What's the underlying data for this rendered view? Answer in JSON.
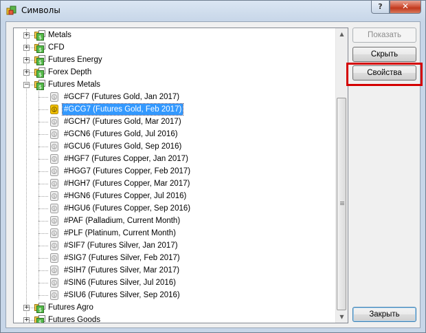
{
  "window": {
    "title": "Символы",
    "help_label": "?",
    "close_label": "✕"
  },
  "tree": {
    "top_groups": [
      {
        "label": "Metals",
        "expander": "+"
      },
      {
        "label": "CFD",
        "expander": "+"
      },
      {
        "label": "Futures Energy",
        "expander": "+"
      },
      {
        "label": "Forex Depth",
        "expander": "+"
      }
    ],
    "expanded_group": {
      "label": "Futures Metals",
      "expander": "−"
    },
    "symbols": [
      {
        "label": "#GCF7  (Futures Gold, Jan 2017)",
        "selected": false
      },
      {
        "label": "#GCG7  (Futures Gold, Feb 2017)",
        "selected": true
      },
      {
        "label": "#GCH7  (Futures Gold, Mar 2017)",
        "selected": false
      },
      {
        "label": "#GCN6  (Futures Gold, Jul 2016)",
        "selected": false
      },
      {
        "label": "#GCU6  (Futures Gold, Sep 2016)",
        "selected": false
      },
      {
        "label": "#HGF7  (Futures Copper, Jan 2017)",
        "selected": false
      },
      {
        "label": "#HGG7  (Futures Copper, Feb 2017)",
        "selected": false
      },
      {
        "label": "#HGH7  (Futures Copper, Mar 2017)",
        "selected": false
      },
      {
        "label": "#HGN6  (Futures Copper, Jul 2016)",
        "selected": false
      },
      {
        "label": "#HGU6  (Futures Copper, Sep 2016)",
        "selected": false
      },
      {
        "label": "#PAF  (Palladium, Current Month)",
        "selected": false
      },
      {
        "label": "#PLF  (Platinum, Current Month)",
        "selected": false
      },
      {
        "label": "#SIF7  (Futures Silver, Jan 2017)",
        "selected": false
      },
      {
        "label": "#SIG7  (Futures Silver, Feb 2017)",
        "selected": false
      },
      {
        "label": "#SIH7  (Futures Silver, Mar 2017)",
        "selected": false
      },
      {
        "label": "#SIN6  (Futures Silver, Jul 2016)",
        "selected": false
      },
      {
        "label": "#SIU6  (Futures Silver, Sep 2016)",
        "selected": false
      }
    ],
    "bottom_groups": [
      {
        "label": "Futures Agro",
        "expander": "+"
      },
      {
        "label": "Futures Goods",
        "expander": "+"
      }
    ]
  },
  "buttons": {
    "show_label": "Показать",
    "hide_label": "Скрыть",
    "properties_label": "Свойства",
    "close_label": "Закрыть"
  },
  "colors": {
    "selection": "#3399ff",
    "highlight_box": "#d40000",
    "folder_green": "#3aa63a",
    "symbol_gold": "#f2c200"
  }
}
